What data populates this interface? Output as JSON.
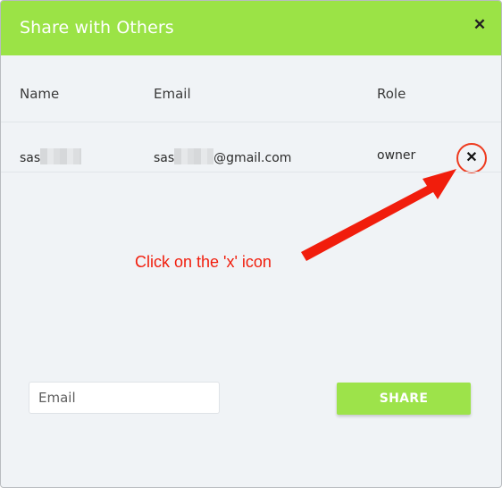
{
  "modal": {
    "title": "Share with Others",
    "close_icon": "close-icon"
  },
  "table": {
    "columns": [
      "Name",
      "Email",
      "Role"
    ],
    "rows": [
      {
        "name_visible": "sas",
        "email_visible_prefix": "sas",
        "email_visible_suffix": "@gmail.com",
        "role": "owner",
        "remove_icon": "close-icon"
      }
    ]
  },
  "annotation": {
    "text": "Click on the 'x' icon",
    "color": "#f11d0c"
  },
  "form": {
    "email_placeholder": "Email",
    "email_value": "",
    "share_label": "SHARE"
  },
  "colors": {
    "header": "#9be346",
    "button": "#9de34a",
    "background": "#f0f3f6",
    "annotation": "#ee3a1e"
  }
}
